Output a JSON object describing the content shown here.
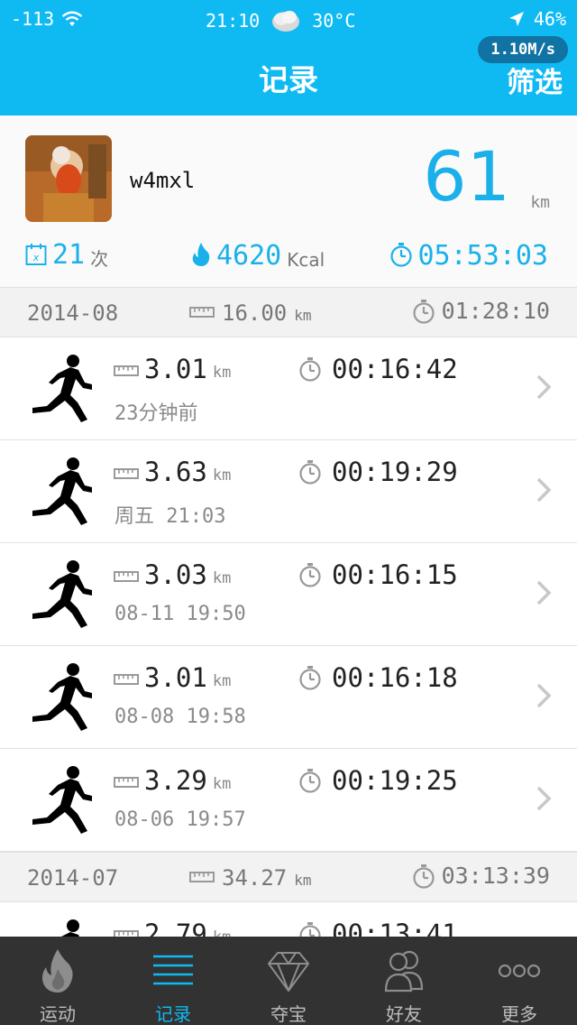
{
  "status_bar": {
    "signal": "-113",
    "time": "21:10",
    "temperature": "30°C",
    "battery": "46%"
  },
  "header": {
    "title": "记录",
    "filter_label": "筛选",
    "speed_badge": "1.10M/s"
  },
  "profile": {
    "username": "w4mxl",
    "total_distance": "61",
    "total_distance_unit": "km",
    "run_count": "21",
    "run_count_unit": "次",
    "calories": "4620",
    "calories_unit": "Kcal",
    "total_time": "05:53:03"
  },
  "months": [
    {
      "label": "2014-08",
      "distance": "16.00",
      "distance_unit": "km",
      "duration": "01:28:10",
      "runs": [
        {
          "distance": "3.01",
          "unit": "km",
          "duration": "00:16:42",
          "when": "23分钟前"
        },
        {
          "distance": "3.63",
          "unit": "km",
          "duration": "00:19:29",
          "when": "周五 21:03"
        },
        {
          "distance": "3.03",
          "unit": "km",
          "duration": "00:16:15",
          "when": "08-11 19:50"
        },
        {
          "distance": "3.01",
          "unit": "km",
          "duration": "00:16:18",
          "when": "08-08 19:58"
        },
        {
          "distance": "3.29",
          "unit": "km",
          "duration": "00:19:25",
          "when": "08-06 19:57"
        }
      ]
    },
    {
      "label": "2014-07",
      "distance": "34.27",
      "distance_unit": "km",
      "duration": "03:13:39",
      "runs": [
        {
          "distance": "2.79",
          "unit": "km",
          "duration": "00:13:41",
          "when": ""
        }
      ]
    }
  ],
  "tabs": [
    {
      "label": "运动",
      "icon": "flame-icon"
    },
    {
      "label": "记录",
      "icon": "list-icon",
      "active": true
    },
    {
      "label": "夺宝",
      "icon": "diamond-icon"
    },
    {
      "label": "好友",
      "icon": "friends-icon"
    },
    {
      "label": "更多",
      "icon": "more-icon"
    }
  ],
  "colors": {
    "accent": "#0fbaf3",
    "header_bg": "#0fbaf3",
    "tabbar_bg": "#323232",
    "stat_blue": "#1ab1ea"
  }
}
